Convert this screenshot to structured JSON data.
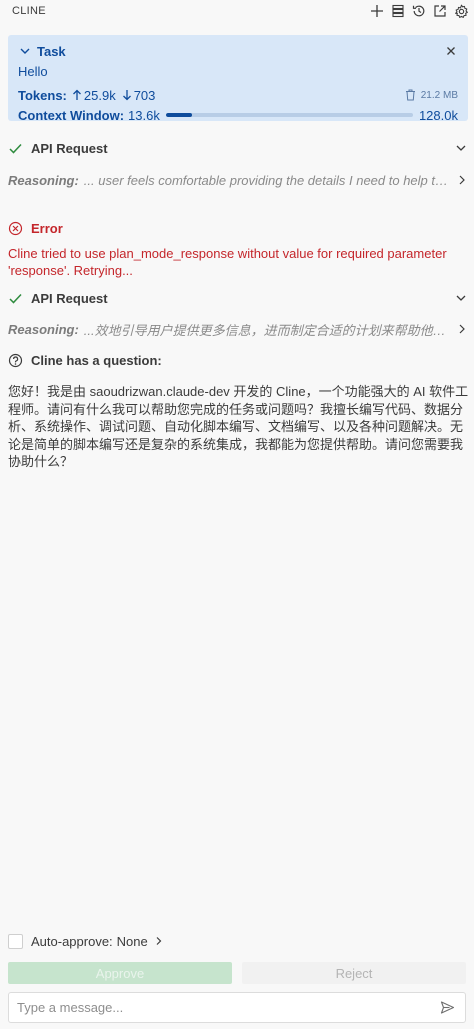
{
  "header": {
    "title": "CLINE",
    "icons": [
      "plus-icon",
      "mcp-servers-icon",
      "history-icon",
      "popout-icon",
      "settings-gear-icon"
    ]
  },
  "task": {
    "label": "Task",
    "message": "Hello",
    "tokens_label": "Tokens:",
    "tokens_in": "25.9k",
    "tokens_out": "703",
    "size": "21.2 MB",
    "context_label": "Context Window:",
    "context_used": "13.6k",
    "context_max": "128.0k",
    "context_fraction": 0.106
  },
  "messages": [
    {
      "type": "api_request",
      "title": "API Request",
      "reasoning_label": "Reasoning:",
      "reasoning_text": "... user feels comfortable providing the details I need to help them best."
    },
    {
      "type": "error",
      "title": "Error",
      "text": "Cline tried to use plan_mode_response without value for required parameter 'response'. Retrying..."
    },
    {
      "type": "api_request",
      "title": "API Request",
      "reasoning_label": "Reasoning:",
      "reasoning_text": "...效地引导用户提供更多信息，进而制定合适的计划来帮助他们解决问题。"
    },
    {
      "type": "question",
      "title": "Cline has a question:",
      "text": "您好！我是由 saoudrizwan.claude-dev 开发的 Cline，一个功能强大的 AI 软件工程师。请问有什么我可以帮助您完成的任务或问题吗？我擅长编写代码、数据分析、系统操作、调试问题、自动化脚本编写、文档编写、以及各种问题解决。无论是简单的脚本编写还是复杂的系统集成，我都能为您提供帮助。请问您需要我协助什么？"
    }
  ],
  "auto_approve": {
    "label": "Auto-approve:",
    "value": "None"
  },
  "buttons": {
    "approve": "Approve",
    "reject": "Reject"
  },
  "input": {
    "placeholder": "Type a message..."
  },
  "colors": {
    "accent": "#0f4c9c",
    "task_bg": "#d8e7f8",
    "success": "#2e8b3e",
    "error": "#c4262b",
    "approve_bg": "#c6e4cd"
  }
}
